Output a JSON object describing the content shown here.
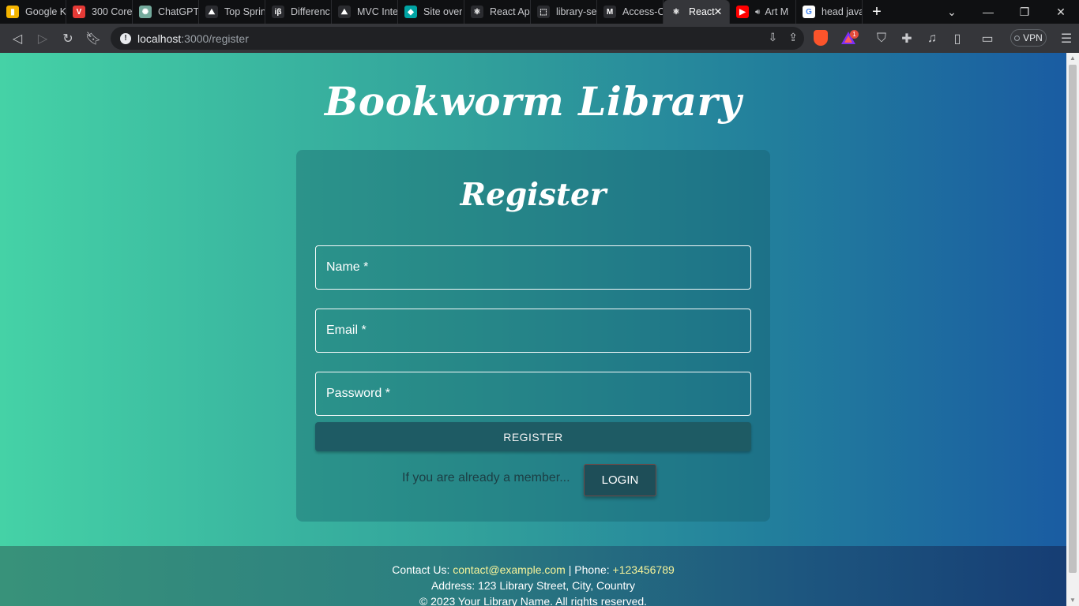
{
  "browser": {
    "tabs": [
      {
        "title": "Google K",
        "icon": "keep-icon",
        "color": "#f4b400"
      },
      {
        "title": "300 Core",
        "icon": "v-logo-icon",
        "color": "#e53935"
      },
      {
        "title": "ChatGPT",
        "icon": "chatgpt-icon",
        "color": "#74aa9c"
      },
      {
        "title": "Top Sprin",
        "icon": "mountain-icon",
        "color": "#2a2b2f"
      },
      {
        "title": "Differenc",
        "icon": "ib-icon",
        "color": "#2a2b2f"
      },
      {
        "title": "MVC Inte",
        "icon": "mountain-icon",
        "color": "#2a2b2f"
      },
      {
        "title": "Site over",
        "icon": "diamond-icon",
        "color": "#00a3a3"
      },
      {
        "title": "React Ap",
        "icon": "react-icon",
        "color": "#2a2b2f"
      },
      {
        "title": "library-se",
        "icon": "codesandbox-icon",
        "color": "#2a2b2f"
      },
      {
        "title": "Access-C",
        "icon": "mdn-icon",
        "color": "#2a2b2f"
      },
      {
        "title": "React",
        "icon": "react-icon",
        "color": "#35363a",
        "active": true
      },
      {
        "title": "Art M",
        "icon": "youtube-icon",
        "color": "#ff0000",
        "audio": true
      },
      {
        "title": "head java",
        "icon": "google-icon",
        "color": "#ffffff"
      }
    ],
    "new_tab": "+",
    "url": {
      "host": "localhost",
      "path": ":3000/register"
    },
    "vpn_label": "VPN",
    "rewards_badge": "1"
  },
  "page": {
    "site_title": "Bookworm Library",
    "card": {
      "title": "Register",
      "fields": {
        "name": {
          "label": "Name *",
          "value": ""
        },
        "email": {
          "label": "Email *",
          "value": ""
        },
        "password": {
          "label": "Password *",
          "value": ""
        }
      },
      "register_button": "REGISTER",
      "member_text": "If you are already a member...",
      "login_button": "LOGIN"
    },
    "footer": {
      "contact_prefix": "Contact Us: ",
      "email": "contact@example.com",
      "phone_prefix": " | Phone: ",
      "phone": "+123456789",
      "address": "Address: 123 Library Street, City, Country",
      "copyright": "© 2023 Your Library Name. All rights reserved."
    }
  }
}
